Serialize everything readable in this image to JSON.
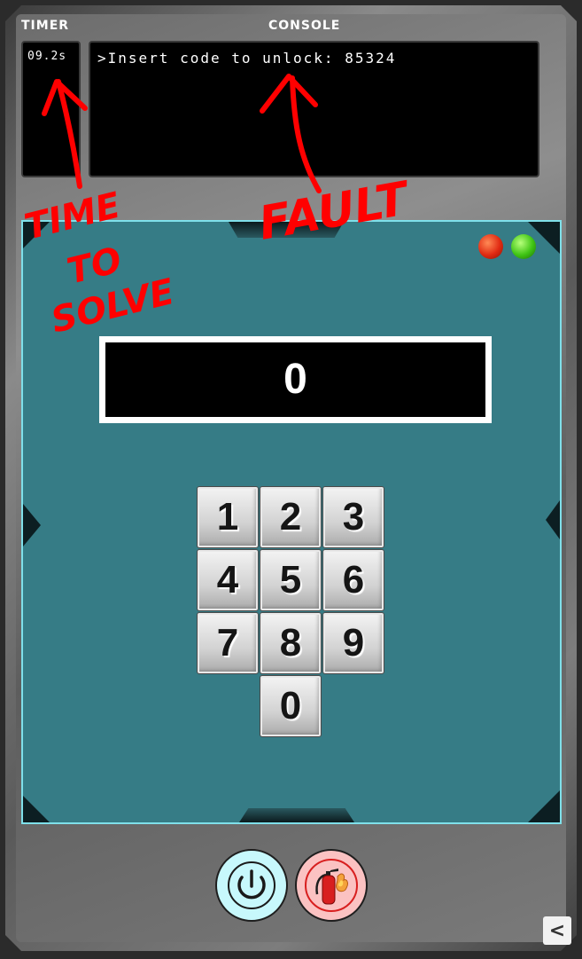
{
  "header": {
    "timer_label": "TIMER",
    "console_label": "CONSOLE"
  },
  "timer": {
    "value": "09.2s"
  },
  "console": {
    "text": ">Insert code to unlock: 85324"
  },
  "panel": {
    "indicators": [
      {
        "name": "red-indicator-light",
        "color": "#e02a12"
      },
      {
        "name": "green-indicator-light",
        "color": "#3fc414"
      }
    ],
    "display_value": "0",
    "background_color": "#367c86"
  },
  "keypad": {
    "keys": [
      "1",
      "2",
      "3",
      "4",
      "5",
      "6",
      "7",
      "8",
      "9",
      "0"
    ]
  },
  "controls": {
    "power_icon": "power-icon",
    "extinguisher_icon": "fire-extinguisher-icon",
    "back_label": "<"
  },
  "annotations": {
    "timer_note": [
      "TIME",
      "TO",
      "SOLVE"
    ],
    "console_note": "FAULT",
    "color": "#ff0000"
  }
}
